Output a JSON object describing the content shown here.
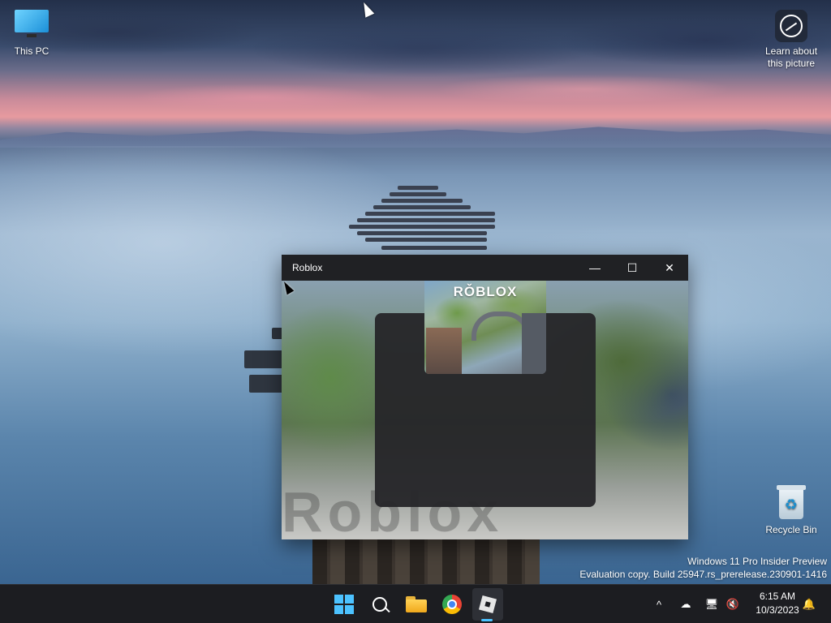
{
  "desktop": {
    "icons": [
      {
        "label": "This PC"
      },
      {
        "label": "Learn about this picture"
      },
      {
        "label": "Recycle Bin"
      }
    ],
    "watermark": {
      "line1": "Windows 11 Pro Insider Preview",
      "line2": "Evaluation copy. Build 25947.rs_prerelease.230901-1416"
    }
  },
  "window": {
    "title": "Roblox",
    "controls": {
      "minimize": "—",
      "maximize": "☐",
      "close": "✕"
    },
    "splash_logo": "RǑBLOX",
    "background_text": "Roblox"
  },
  "taskbar": {
    "apps": [
      {
        "name": "start-icon"
      },
      {
        "name": "search-icon"
      },
      {
        "name": "file-explorer-icon"
      },
      {
        "name": "chrome-icon"
      },
      {
        "name": "roblox-icon",
        "active": true
      }
    ],
    "tray": {
      "chevron": "^",
      "time": "6:15 AM",
      "date": "10/3/2023"
    }
  },
  "colors": {
    "accent": "#4cc2ff",
    "taskbar": "#1c1d21",
    "titlebar": "#202124"
  }
}
